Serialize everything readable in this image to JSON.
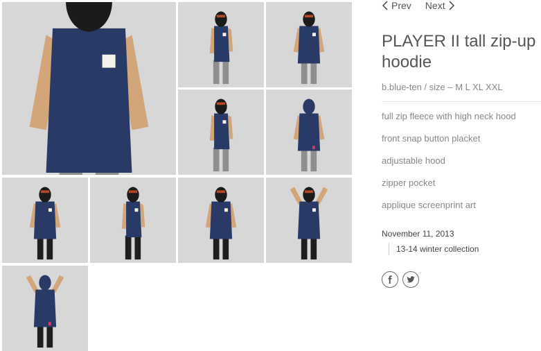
{
  "nav": {
    "prev_label": "Prev",
    "next_label": "Next"
  },
  "product": {
    "title": "PLAYER II tall zip-up hoodie",
    "subtitle": "b.blue-ten / size – M L XL XXL",
    "features": [
      "full zip fleece with high neck hood",
      "front snap button placket",
      "adjustable hood",
      "zipper pocket",
      "applique screenprint art"
    ]
  },
  "meta": {
    "date": "November 11, 2013",
    "collection": "13-14 winter collection"
  },
  "social": {
    "icons": [
      "facebook-icon",
      "twitter-icon"
    ]
  },
  "colors": {
    "hoodie": "#2a3a66",
    "sleeve": "#d2a678",
    "pants_grey": "#8e8e8e",
    "pants_black": "#1e1e1e",
    "background": "#d7d7d7"
  },
  "gallery": {
    "photos": [
      {
        "view": "front-closeup",
        "pants": "grey"
      },
      {
        "view": "side",
        "pants": "grey"
      },
      {
        "view": "front-hood-up",
        "pants": "grey"
      },
      {
        "view": "side",
        "pants": "grey"
      },
      {
        "view": "back",
        "pants": "grey"
      },
      {
        "view": "front",
        "pants": "black"
      },
      {
        "view": "side",
        "pants": "black"
      },
      {
        "view": "front",
        "pants": "black"
      },
      {
        "view": "front-arms-up",
        "pants": "black"
      },
      {
        "view": "back-arms-up",
        "pants": "black"
      }
    ]
  }
}
